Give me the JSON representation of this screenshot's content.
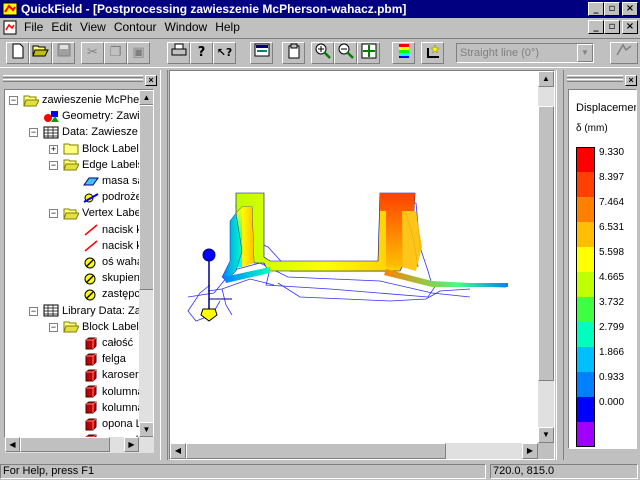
{
  "title_bar": {
    "title": "QuickField - [Postprocessing zawieszenie McPherson-wahacz.pbm]"
  },
  "menu": [
    "File",
    "Edit",
    "View",
    "Contour",
    "Window",
    "Help"
  ],
  "toolbar": {
    "buttons": [
      "new-icon",
      "open-icon",
      "save-icon",
      "cut-icon",
      "copy-icon",
      "paste-icon",
      "print-icon",
      "help-icon",
      "context-help-icon",
      "view-table-icon",
      "copy-picture-icon",
      "zoom-in-icon",
      "zoom-out-icon",
      "zoom-fit-icon",
      "color-map-icon",
      "add-point-icon"
    ],
    "contour_combo": "Straight line (0°)"
  },
  "tree": {
    "items": [
      {
        "label": "zawieszenie McPhe",
        "level": 0,
        "icon": "folder-open-icon",
        "expander": "−"
      },
      {
        "label": "Geometry: Zawi",
        "level": 1,
        "icon": "geometry-icon",
        "expander": ""
      },
      {
        "label": "Data: Zawiesze",
        "level": 1,
        "icon": "data-grid-icon",
        "expander": "−"
      },
      {
        "label": "Block Label",
        "level": 2,
        "icon": "folder-icon",
        "expander": "+"
      },
      {
        "label": "Edge Labels",
        "level": 2,
        "icon": "folder-open-icon",
        "expander": "−"
      },
      {
        "label": "masa sa",
        "level": 3,
        "icon": "edge-label-icon",
        "expander": ""
      },
      {
        "label": "podroże",
        "level": 3,
        "icon": "edge-support-icon",
        "expander": ""
      },
      {
        "label": "Vertex Labe",
        "level": 2,
        "icon": "folder-open-icon",
        "expander": "−"
      },
      {
        "label": "nacisk k",
        "level": 3,
        "icon": "red-line-icon",
        "expander": ""
      },
      {
        "label": "nacisk k",
        "level": 3,
        "icon": "red-line-icon",
        "expander": ""
      },
      {
        "label": "oś waha",
        "level": 3,
        "icon": "vertex-support-icon",
        "expander": ""
      },
      {
        "label": "skupien",
        "level": 3,
        "icon": "vertex-support-icon",
        "expander": ""
      },
      {
        "label": "zastępcz",
        "level": 3,
        "icon": "vertex-support-icon",
        "expander": ""
      },
      {
        "label": "Library Data: Za",
        "level": 1,
        "icon": "data-grid-icon",
        "expander": "−"
      },
      {
        "label": "Block Label",
        "level": 2,
        "icon": "folder-open-icon",
        "expander": "−"
      },
      {
        "label": "całość",
        "level": 3,
        "icon": "red-cube-icon",
        "expander": ""
      },
      {
        "label": "felga",
        "level": 3,
        "icon": "red-cube-icon",
        "expander": ""
      },
      {
        "label": "karoseri",
        "level": 3,
        "icon": "red-cube-icon",
        "expander": ""
      },
      {
        "label": "kolumna",
        "level": 3,
        "icon": "red-cube-icon",
        "expander": ""
      },
      {
        "label": "kolumna",
        "level": 3,
        "icon": "red-cube-icon",
        "expander": ""
      },
      {
        "label": "opona L",
        "level": 3,
        "icon": "red-cube-icon",
        "expander": ""
      },
      {
        "label": "opona L",
        "level": 3,
        "icon": "red-cube-icon",
        "expander": ""
      }
    ]
  },
  "legend": {
    "title": "Displacemer",
    "unit": "δ (mm)",
    "values": [
      "9.330",
      "8.397",
      "7.464",
      "6.531",
      "5.598",
      "4.665",
      "3.732",
      "2.799",
      "1.866",
      "0.933",
      "0.000"
    ],
    "colors": [
      "#ff0000",
      "#ff4000",
      "#ff8000",
      "#ffbf00",
      "#ffff00",
      "#bfff00",
      "#40ff40",
      "#00ffbf",
      "#00bfff",
      "#0080ff",
      "#0000ff",
      "#a000ff"
    ]
  },
  "status": {
    "help": "For Help, press F1",
    "coords": "720.0, 815.0"
  }
}
